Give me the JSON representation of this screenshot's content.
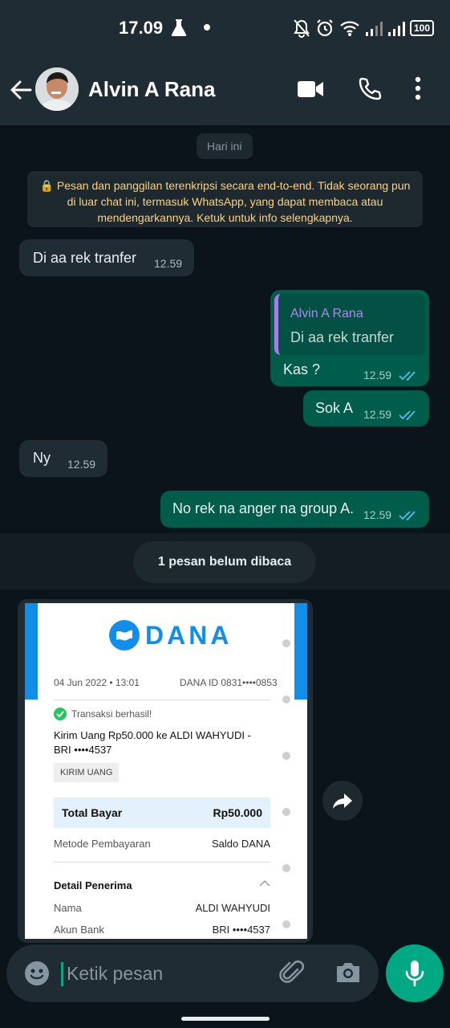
{
  "status_bar": {
    "time": "17.09",
    "battery": "100"
  },
  "header": {
    "contact_name": "Alvin A Rana"
  },
  "chat": {
    "day_chip": "Hari ini",
    "encryption_notice": "🔒 Pesan dan panggilan terenkripsi secara end-to-end. Tidak seorang pun di luar chat ini, termasuk WhatsApp, yang dapat membaca atau mendengarkannya. Ketuk untuk info selengkapnya.",
    "messages": [
      {
        "direction": "in",
        "text": "Di aa rek tranfer",
        "time": "12.59"
      },
      {
        "direction": "out",
        "quote_author": "Alvin A Rana",
        "quote_text": "Di aa rek tranfer",
        "text": "Kas ?",
        "time": "12.59",
        "status": "read"
      },
      {
        "direction": "out",
        "text": "Sok A",
        "time": "12.59",
        "status": "read"
      },
      {
        "direction": "in",
        "text": "Ny",
        "time": "12.59"
      },
      {
        "direction": "out",
        "text": "No rek na anger na group A.",
        "time": "12.59",
        "status": "read"
      }
    ],
    "unread_label": "1 pesan belum dibaca",
    "receipt": {
      "brand": "DANA",
      "date": "04 Jun 2022 • 13:01",
      "dana_id": "DANA ID 0831••••0853",
      "status": "Transaksi berhasil!",
      "title": "Kirim Uang Rp50.000 ke ALDI WAHYUDI - BRI ••••4537",
      "tag": "KIRIM UANG",
      "total_label": "Total Bayar",
      "total_value": "Rp50.000",
      "method_label": "Metode Pembayaran",
      "method_value": "Saldo DANA",
      "recipient_header": "Detail Penerima",
      "name_label": "Nama",
      "name_value": "ALDI WAHYUDI",
      "bank_label": "Akun Bank",
      "bank_value": "BRI ••••4537",
      "watermark": "DANA"
    }
  },
  "input": {
    "placeholder": "Ketik pesan"
  },
  "colors": {
    "outgoing": "#005c4b",
    "incoming": "#202c33",
    "accent": "#00a884",
    "read_ticks": "#53bdeb",
    "dana_blue": "#108ee9"
  }
}
